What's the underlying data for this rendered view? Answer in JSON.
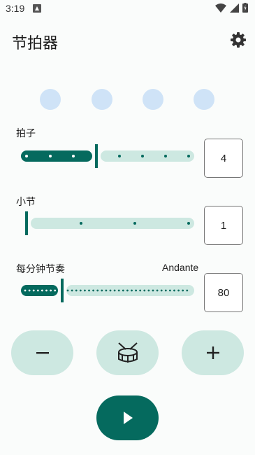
{
  "status_bar": {
    "time": "3:19"
  },
  "app": {
    "title": "节拍器"
  },
  "beats_per_bar": {
    "label": "拍子",
    "value": "4",
    "fraction": 0.35
  },
  "bars": {
    "label": "小节",
    "value": "1",
    "fraction": 0.0
  },
  "tempo": {
    "label": "每分钟节奏",
    "tempo_name": "Andante",
    "value": "80",
    "fraction": 0.22
  },
  "colors": {
    "accent": "#056a5e",
    "track_inactive": "#cde8e1",
    "beat_dot": "#cfe3f7"
  },
  "icons": [
    "gear-icon",
    "minus-icon",
    "drum-icon",
    "plus-icon",
    "play-icon"
  ]
}
